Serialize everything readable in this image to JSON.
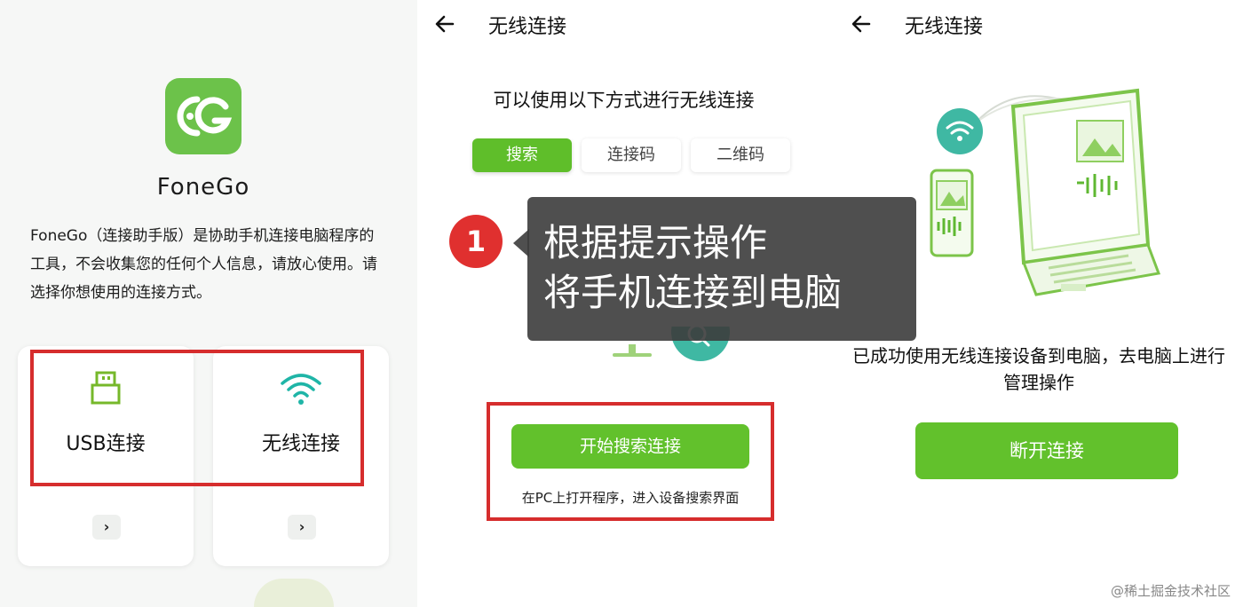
{
  "panel_login": {
    "app_name": "FoneGo",
    "description": "FoneGo（连接助手版）是协助手机连接电脑程序的工具，不会收集您的任何个人信息，请放心使用。请选择你想使用的连接方式。",
    "options": [
      {
        "label": "USB连接",
        "icon": "usb-icon"
      },
      {
        "label": "无线连接",
        "icon": "wifi-icon"
      }
    ],
    "arrow_glyph": "›"
  },
  "panel_search": {
    "header_title": "无线连接",
    "subtitle": "可以使用以下方式进行无线连接",
    "tabs": [
      "搜索",
      "连接码",
      "二维码"
    ],
    "active_tab": "搜索",
    "start_button": "开始搜索连接",
    "hint": "在PC上打开程序，进入设备搜索界面"
  },
  "panel_connected": {
    "header_title": "无线连接",
    "message": "已成功使用无线连接设备到电脑，去电脑上进行管理操作",
    "disconnect_button": "断开连接"
  },
  "overlay": {
    "step_number": "1",
    "line1": "根据提示操作",
    "line2": "将手机连接到电脑"
  },
  "watermark": "@稀土掘金技术社区",
  "colors": {
    "accent_green": "#62c12c",
    "highlight_red": "#d62d2d",
    "badge_red": "#e0302f"
  }
}
